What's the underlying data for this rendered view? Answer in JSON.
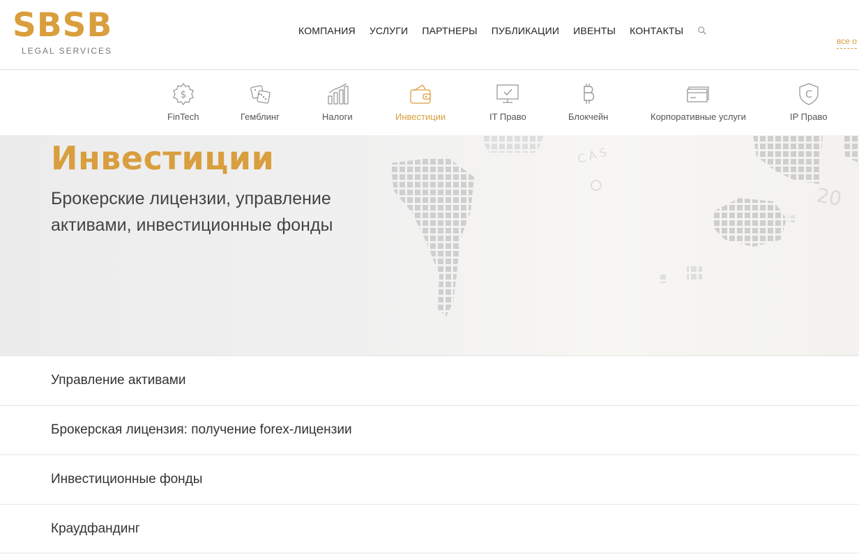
{
  "logo": {
    "mark": "SBSB",
    "sub": "LEGAL SERVICES"
  },
  "nav": {
    "items": [
      "КОМПАНИЯ",
      "УСЛУГИ",
      "ПАРТНЕРЫ",
      "ПУБЛИКАЦИИ",
      "ИВЕНТЫ",
      "КОНТАКТЫ"
    ],
    "search_icon": "search-icon"
  },
  "all_link": "все о",
  "categories": [
    {
      "label": "FinTech",
      "icon": "dollar-coin-icon",
      "active": false
    },
    {
      "label": "Гемблинг",
      "icon": "dice-icon",
      "active": false
    },
    {
      "label": "Налоги",
      "icon": "bar-chart-icon",
      "active": false
    },
    {
      "label": "Инвестиции",
      "icon": "wallet-icon",
      "active": true
    },
    {
      "label": "IT Право",
      "icon": "monitor-check-icon",
      "active": false
    },
    {
      "label": "Блокчейн",
      "icon": "bitcoin-icon",
      "active": false
    },
    {
      "label": "Корпоративные услуги",
      "icon": "card-icon",
      "active": false
    },
    {
      "label": "IP Право",
      "icon": "copyright-shield-icon",
      "active": false
    }
  ],
  "hero": {
    "title": "Инвестиции",
    "subtitle": "Брокерские лицензии, управление активами, инвестиционные фонды"
  },
  "services": [
    "Управление активами",
    "Брокерская лицензия: получение forex-лицензии",
    "Инвестиционные фонды",
    "Краудфандинг"
  ],
  "colors": {
    "accent": "#d99e3d",
    "text": "#333333",
    "muted": "#555555"
  }
}
